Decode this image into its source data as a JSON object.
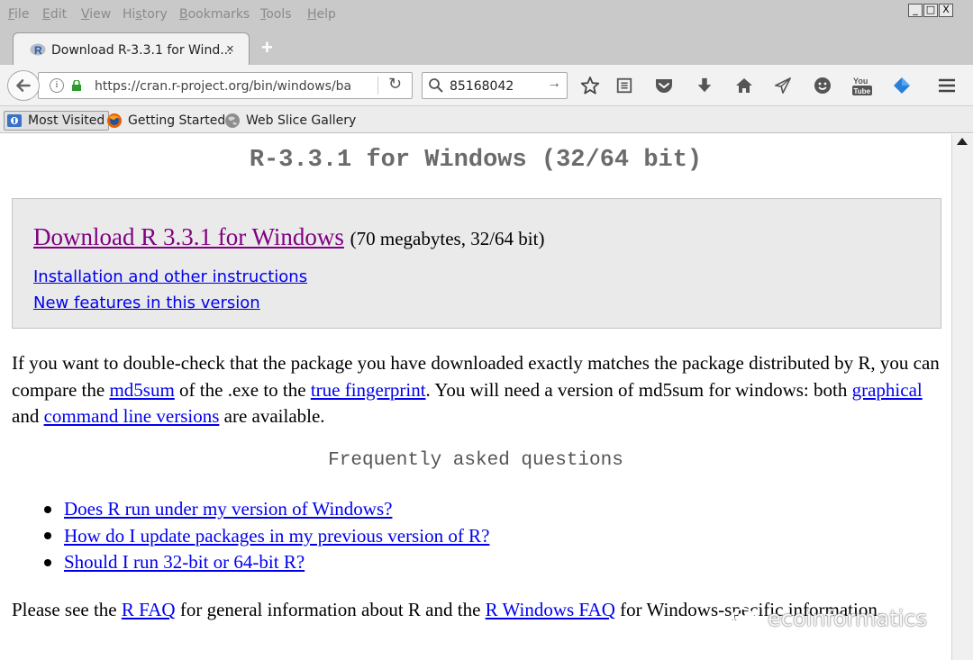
{
  "menu": {
    "items": [
      {
        "pre": "",
        "u": "F",
        "post": "ile"
      },
      {
        "pre": "",
        "u": "E",
        "post": "dit"
      },
      {
        "pre": "",
        "u": "V",
        "post": "iew"
      },
      {
        "pre": "Hi",
        "u": "s",
        "post": "tory"
      },
      {
        "pre": "",
        "u": "B",
        "post": "ookmarks"
      },
      {
        "pre": "",
        "u": "T",
        "post": "ools"
      },
      {
        "pre": "",
        "u": "H",
        "post": "elp"
      }
    ],
    "minimize": "_",
    "maximize": "□",
    "close": "X"
  },
  "tab": {
    "title": "Download R-3.3.1 for Wind...",
    "close": "×",
    "new_tab": "+"
  },
  "nav": {
    "url": "https://cran.r-project.org/bin/windows/base",
    "info": "i",
    "reload": "↻",
    "search_value": "85168042",
    "search_go": "→",
    "icons": [
      "star-icon",
      "reading-list-icon",
      "pocket-icon",
      "download-icon",
      "home-icon",
      "send-icon",
      "chat-icon",
      "youtube-icon",
      "diamond-icon",
      "menu-icon"
    ]
  },
  "bookmarks": {
    "items": [
      "Most Visited",
      "Getting Started",
      "Web Slice Gallery"
    ]
  },
  "page": {
    "title": "R-3.3.1 for Windows (32/64 bit)",
    "download_link": "Download R 3.3.1 for Windows",
    "download_meta": "(70 megabytes, 32/64 bit)",
    "install_link": "Installation and other instructions",
    "features_link": "New features in this version",
    "p1_a": "If you want to double-check that the package you have downloaded exactly matches the package distributed by R, you can compare the ",
    "p1_md5": "md5sum",
    "p1_b": " of the .exe to the ",
    "p1_fp": "true fingerprint",
    "p1_c": ". You will need a version of md5sum for windows: both ",
    "p1_graphical": "graphical",
    "p1_d": " and ",
    "p1_cmd": "command line versions",
    "p1_e": " are available.",
    "faq_heading": "Frequently asked questions",
    "faq": [
      "Does R run under my version of Windows?",
      "How do I update packages in my previous version of R?",
      "Should I run 32-bit or 64-bit R?"
    ],
    "p2_a": "Please see the ",
    "p2_rfaq": "R FAQ",
    "p2_b": " for general information about R and the ",
    "p2_rwfaq": "R Windows FAQ",
    "p2_c": " for Windows-specific information.",
    "watermark": "ecoinformatics"
  }
}
